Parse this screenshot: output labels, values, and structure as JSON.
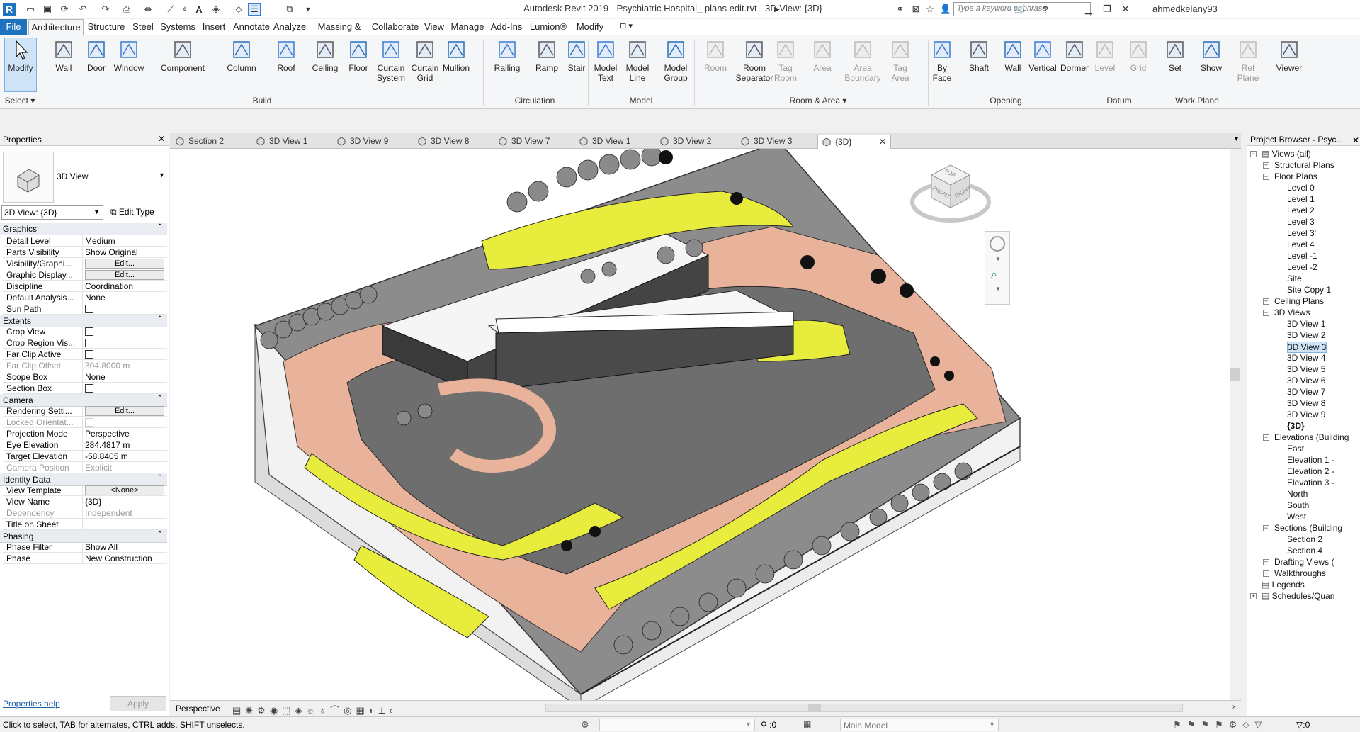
{
  "app": {
    "title": "Autodesk Revit 2019 - Psychiatric Hospital_ plans edit.rvt - 3D View: {3D}",
    "search_placeholder": "Type a keyword or phrase",
    "user": "ahmedkelany93"
  },
  "ribbon_tabs": [
    "File",
    "Architecture",
    "Structure",
    "Steel",
    "Systems",
    "Insert",
    "Annotate",
    "Analyze",
    "Massing & Site",
    "Collaborate",
    "View",
    "Manage",
    "Add-Ins",
    "Lumion®",
    "Modify"
  ],
  "ribbon": {
    "buttons": [
      {
        "l1": "Modify",
        "l2": "",
        "icon": "cursor-icon"
      },
      {
        "l1": "Wall",
        "l2": "",
        "icon": "wall-icon"
      },
      {
        "l1": "Door",
        "l2": "",
        "icon": "door-icon"
      },
      {
        "l1": "Window",
        "l2": "",
        "icon": "window-icon"
      },
      {
        "l1": "Component",
        "l2": "",
        "icon": "component-icon"
      },
      {
        "l1": "Column",
        "l2": "",
        "icon": "column-icon"
      },
      {
        "l1": "Roof",
        "l2": "",
        "icon": "roof-icon"
      },
      {
        "l1": "Ceiling",
        "l2": "",
        "icon": "ceiling-icon"
      },
      {
        "l1": "Floor",
        "l2": "",
        "icon": "floor-icon"
      },
      {
        "l1": "Curtain",
        "l2": "System",
        "icon": "curtain-system-icon"
      },
      {
        "l1": "Curtain",
        "l2": "Grid",
        "icon": "curtain-grid-icon"
      },
      {
        "l1": "Mullion",
        "l2": "",
        "icon": "mullion-icon"
      },
      {
        "l1": "Railing",
        "l2": "",
        "icon": "railing-icon"
      },
      {
        "l1": "Ramp",
        "l2": "",
        "icon": "ramp-icon"
      },
      {
        "l1": "Stair",
        "l2": "",
        "icon": "stair-icon"
      },
      {
        "l1": "Model",
        "l2": "Text",
        "icon": "model-text-icon"
      },
      {
        "l1": "Model",
        "l2": "Line",
        "icon": "model-line-icon"
      },
      {
        "l1": "Model",
        "l2": "Group",
        "icon": "model-group-icon"
      },
      {
        "l1": "Room",
        "l2": "",
        "icon": "room-icon",
        "disabled": true
      },
      {
        "l1": "Room",
        "l2": "Separator",
        "icon": "room-separator-icon"
      },
      {
        "l1": "Tag",
        "l2": "Room",
        "icon": "tag-room-icon",
        "disabled": true
      },
      {
        "l1": "Area",
        "l2": "",
        "icon": "area-icon",
        "disabled": true
      },
      {
        "l1": "Area",
        "l2": "Boundary",
        "icon": "area-boundary-icon",
        "disabled": true
      },
      {
        "l1": "Tag",
        "l2": "Area",
        "icon": "tag-area-icon",
        "disabled": true
      },
      {
        "l1": "By",
        "l2": "Face",
        "icon": "by-face-icon"
      },
      {
        "l1": "Shaft",
        "l2": "",
        "icon": "shaft-icon"
      },
      {
        "l1": "Wall",
        "l2": "",
        "icon": "opening-wall-icon"
      },
      {
        "l1": "Vertical",
        "l2": "",
        "icon": "vertical-icon"
      },
      {
        "l1": "Dormer",
        "l2": "",
        "icon": "dormer-icon"
      },
      {
        "l1": "Level",
        "l2": "",
        "icon": "level-icon",
        "disabled": true
      },
      {
        "l1": "Grid",
        "l2": "",
        "icon": "grid-icon",
        "disabled": true
      },
      {
        "l1": "Set",
        "l2": "",
        "icon": "set-icon"
      },
      {
        "l1": "Show",
        "l2": "",
        "icon": "show-icon"
      },
      {
        "l1": "Ref",
        "l2": "Plane",
        "icon": "ref-plane-icon",
        "disabled": true
      },
      {
        "l1": "Viewer",
        "l2": "",
        "icon": "viewer-icon"
      }
    ],
    "groups": [
      "Select",
      "Build",
      "Circulation",
      "Model",
      "Room & Area",
      "Opening",
      "Datum",
      "Work Plane"
    ]
  },
  "properties": {
    "title": "Properties",
    "type_name": "3D View",
    "selector": "3D View: {3D}",
    "edit_type": "Edit Type",
    "help": "Properties help",
    "apply": "Apply",
    "categories": {
      "graphics": "Graphics",
      "extents": "Extents",
      "camera": "Camera",
      "identity": "Identity Data",
      "phasing": "Phasing"
    },
    "rows": [
      {
        "k": "Detail Level",
        "v": "Medium"
      },
      {
        "k": "Parts Visibility",
        "v": "Show Original"
      },
      {
        "k": "Visibility/Graphi...",
        "v": "Edit..."
      },
      {
        "k": "Graphic Display...",
        "v": "Edit..."
      },
      {
        "k": "Discipline",
        "v": "Coordination"
      },
      {
        "k": "Default Analysis...",
        "v": "None"
      },
      {
        "k": "Sun Path",
        "v": ""
      },
      {
        "k": "Crop View",
        "v": ""
      },
      {
        "k": "Crop Region Vis...",
        "v": ""
      },
      {
        "k": "Far Clip Active",
        "v": ""
      },
      {
        "k": "Far Clip Offset",
        "v": "304.8000 m"
      },
      {
        "k": "Scope Box",
        "v": "None"
      },
      {
        "k": "Section Box",
        "v": ""
      },
      {
        "k": "Rendering Setti...",
        "v": "Edit..."
      },
      {
        "k": "Locked Orientat...",
        "v": ""
      },
      {
        "k": "Projection Mode",
        "v": "Perspective"
      },
      {
        "k": "Eye Elevation",
        "v": "284.4817 m"
      },
      {
        "k": "Target Elevation",
        "v": "-58.8405 m"
      },
      {
        "k": "Camera Position",
        "v": "Explicit"
      },
      {
        "k": "View Template",
        "v": "<None>"
      },
      {
        "k": "View Name",
        "v": "{3D}"
      },
      {
        "k": "Dependency",
        "v": "Independent"
      },
      {
        "k": "Title on Sheet",
        "v": ""
      },
      {
        "k": "Phase Filter",
        "v": "Show All"
      },
      {
        "k": "Phase",
        "v": "New Construction"
      }
    ]
  },
  "view_tabs": [
    "Section 2",
    "3D View 1",
    "3D View 9",
    "3D View 8",
    "3D View 7",
    "3D View 1",
    "3D View 2",
    "3D View 3",
    "{3D}"
  ],
  "viewcube": {
    "top": "TOP",
    "front": "FRONT",
    "right": "RIGHT"
  },
  "view_control": {
    "mode": "Perspective"
  },
  "browser": {
    "title": "Project Browser - Psyc...",
    "items": [
      "Views (all)",
      "Structural Plans",
      "Floor Plans",
      "Level 0",
      "Level 1",
      "Level 2",
      "Level 3",
      "Level 3'",
      "Level 4",
      "Level -1",
      "Level -2",
      "Site",
      "Site Copy 1",
      "Ceiling Plans",
      "3D Views",
      "3D View 1",
      "3D View 2",
      "3D View 3",
      "3D View 4",
      "3D View 5",
      "3D View 6",
      "3D View 7",
      "3D View 8",
      "3D View 9",
      "{3D}",
      "Elevations (Building",
      "East",
      "Elevation 1 -",
      "Elevation 2 -",
      "Elevation 3 -",
      "North",
      "South",
      "West",
      "Sections (Building",
      "Section 2",
      "Section 4",
      "Drafting Views (",
      "Walkthroughs",
      "Legends",
      "Schedules/Quan"
    ]
  },
  "status": {
    "hint": "Click to select, TAB for alternates, CTRL adds, SHIFT unselects.",
    "zero": ":0",
    "model": "Main Model",
    "filter_count": ":0"
  },
  "colors": {
    "accent": "#1e73be",
    "paving": "#e8b39a",
    "grass": "#e8ec3c",
    "trees": "#8a8a8a"
  }
}
